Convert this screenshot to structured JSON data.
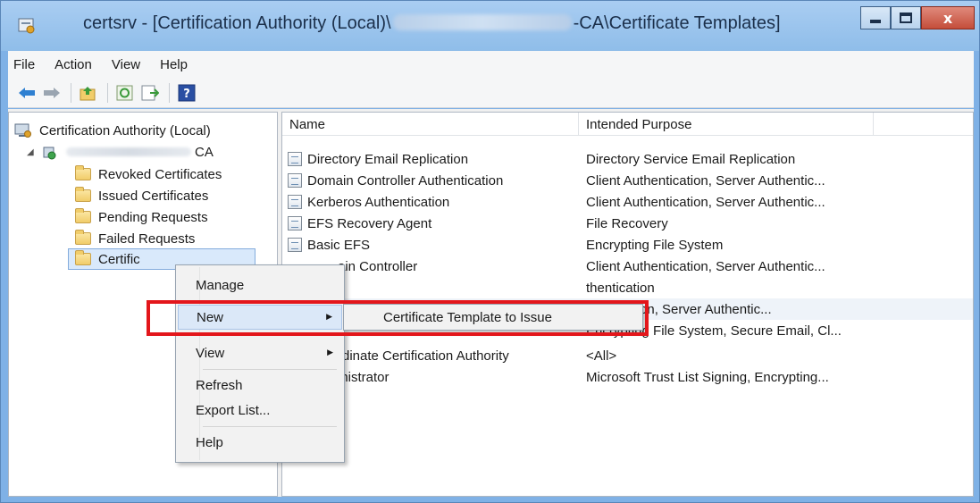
{
  "window": {
    "title_prefix": "certsrv - [Certification Authority (Local)\\",
    "title_suffix": "-CA\\Certificate Templates]",
    "close_label": "x"
  },
  "menubar": {
    "items": [
      "File",
      "Action",
      "View",
      "Help"
    ]
  },
  "toolbar": {
    "icons": [
      "back-arrow-icon",
      "forward-arrow-icon",
      "up-folder-icon",
      "refresh-icon",
      "export-list-icon",
      "help-icon"
    ]
  },
  "tree": {
    "root_label": "Certification Authority (Local)",
    "ca_suffix": "CA",
    "children": [
      "Revoked Certificates",
      "Issued Certificates",
      "Pending Requests",
      "Failed Requests"
    ],
    "selected_partial": "Certific"
  },
  "list": {
    "headers": {
      "name": "Name",
      "purpose": "Intended Purpose"
    },
    "rows": [
      {
        "name": "Directory Email Replication",
        "purpose": "Directory Service Email Replication"
      },
      {
        "name": "Domain Controller Authentication",
        "purpose": "Client Authentication, Server Authentic..."
      },
      {
        "name": "Kerberos Authentication",
        "purpose": "Client Authentication, Server Authentic..."
      },
      {
        "name": "EFS Recovery Agent",
        "purpose": "File Recovery"
      },
      {
        "name": "Basic EFS",
        "purpose": "Encrypting File System"
      },
      {
        "name": "ain Controller",
        "purpose": "Client Authentication, Server Authentic..."
      },
      {
        "name": "",
        "purpose": "thentication"
      },
      {
        "name": "",
        "purpose": "thentication, Server Authentic..."
      },
      {
        "name": "",
        "purpose": "Encrypting File System, Secure Email, Cl..."
      },
      {
        "name": "rdinate Certification Authority",
        "purpose": "<All>"
      },
      {
        "name": "inistrator",
        "purpose": "Microsoft Trust List Signing, Encrypting..."
      }
    ]
  },
  "context_menu": {
    "items": [
      "Manage",
      "New",
      "View",
      "Refresh",
      "Export List...",
      "Help"
    ],
    "submenu_item": "Certificate Template to Issue"
  }
}
